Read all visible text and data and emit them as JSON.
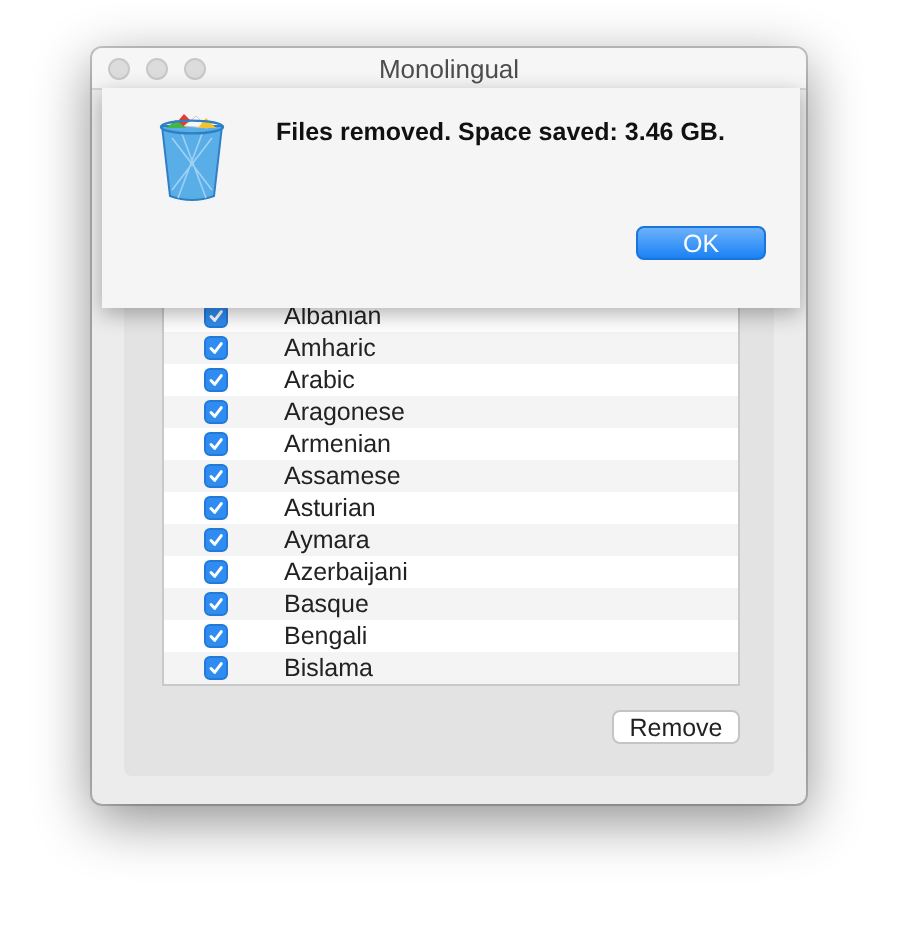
{
  "window": {
    "title": "Monolingual"
  },
  "alert": {
    "message": "Files removed. Space saved: 3.46 GB.",
    "button": "OK"
  },
  "languages": [
    {
      "name": "Albanian",
      "checked": true
    },
    {
      "name": "Amharic",
      "checked": true
    },
    {
      "name": "Arabic",
      "checked": true
    },
    {
      "name": "Aragonese",
      "checked": true
    },
    {
      "name": "Armenian",
      "checked": true
    },
    {
      "name": "Assamese",
      "checked": true
    },
    {
      "name": "Asturian",
      "checked": true
    },
    {
      "name": "Aymara",
      "checked": true
    },
    {
      "name": "Azerbaijani",
      "checked": true
    },
    {
      "name": "Basque",
      "checked": true
    },
    {
      "name": "Bengali",
      "checked": true
    },
    {
      "name": "Bislama",
      "checked": true
    }
  ],
  "remove_button": "Remove"
}
